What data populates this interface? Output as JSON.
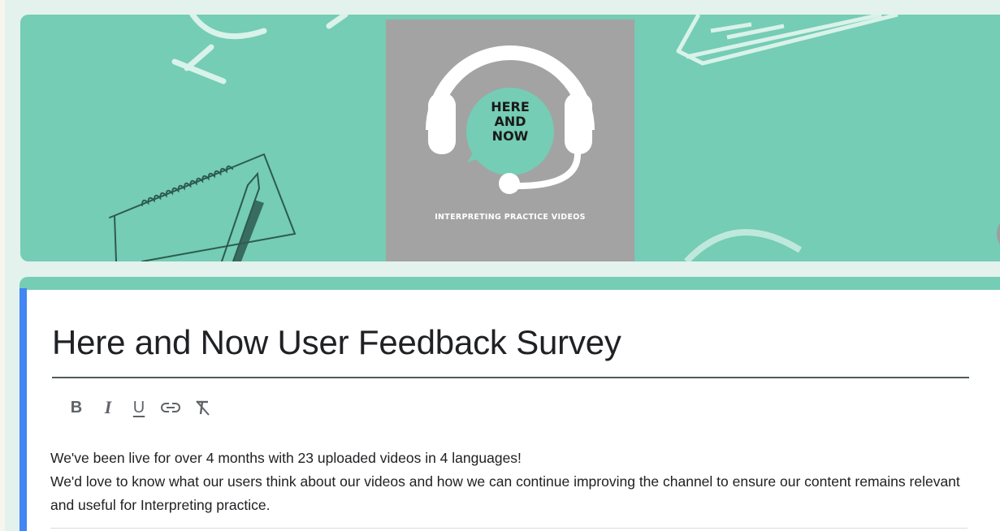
{
  "header": {
    "logo": {
      "line1": "HERE",
      "line2": "AND",
      "line3": "NOW",
      "tagline": "INTERPRETING PRACTICE VIDEOS"
    }
  },
  "form": {
    "title": "Here and Now User Feedback Survey",
    "toolbar": {
      "bold_label": "B",
      "italic_label": "I",
      "underline_label": "U",
      "link_icon": "link-icon",
      "clear_format_icon": "clear-format-icon"
    },
    "description": {
      "line1": "We've been live for over 4 months with 23 uploaded videos in 4 languages!",
      "line2": "We'd love to know what our users think about our videos and how we can continue improving the channel to ensure our content remains relevant and useful for Interpreting practice."
    }
  },
  "colors": {
    "banner": "#74cdb4",
    "logo_box": "#a3a3a3",
    "accent": "#4285f4",
    "page_bg": "#e3f2ed"
  }
}
